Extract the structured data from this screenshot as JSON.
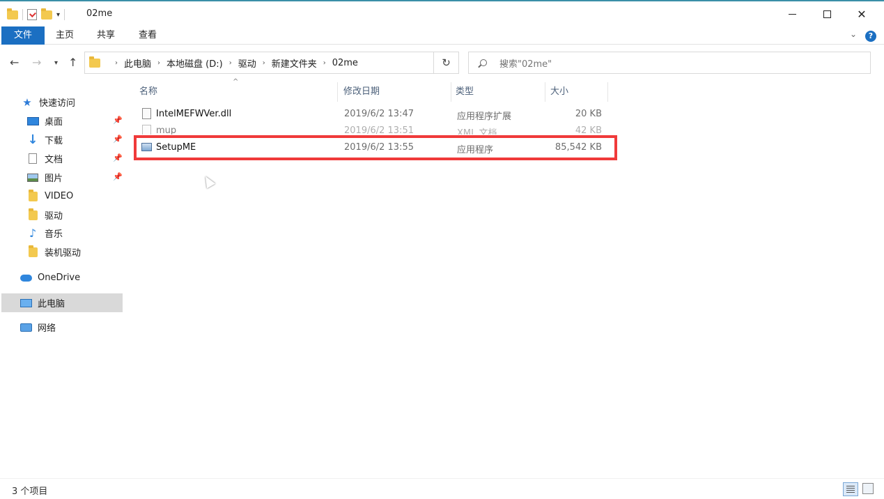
{
  "window": {
    "title": "02me",
    "controls": {
      "minimize": "minimize-icon",
      "maximize": "maximize-icon",
      "close": "✕"
    }
  },
  "ribbon": {
    "tabs": [
      "文件",
      "主页",
      "共享",
      "查看"
    ],
    "help": "?"
  },
  "navigation": {
    "breadcrumb": [
      "此电脑",
      "本地磁盘 (D:)",
      "驱动",
      "新建文件夹",
      "02me"
    ],
    "search_placeholder": "搜索\"02me\""
  },
  "sidebar": {
    "quick_access": "快速访问",
    "pinned": [
      {
        "label": "桌面",
        "icon": "desktop-icon"
      },
      {
        "label": "下载",
        "icon": "download-icon"
      },
      {
        "label": "文档",
        "icon": "document-icon"
      },
      {
        "label": "图片",
        "icon": "pictures-icon"
      }
    ],
    "folders": [
      {
        "label": "VIDEO",
        "icon": "folder-icon"
      },
      {
        "label": "驱动",
        "icon": "folder-icon"
      },
      {
        "label": "音乐",
        "icon": "music-icon"
      },
      {
        "label": "装机驱动",
        "icon": "folder-icon"
      }
    ],
    "onedrive": "OneDrive",
    "this_pc": "此电脑",
    "network": "网络"
  },
  "file_list": {
    "columns": [
      "名称",
      "修改日期",
      "类型",
      "大小"
    ],
    "rows": [
      {
        "name": "IntelMEFWVer.dll",
        "date": "2019/6/2 13:47",
        "type": "应用程序扩展",
        "size": "20 KB"
      },
      {
        "name": "mup",
        "date": "2019/6/2 13:51",
        "type": "XML 文档",
        "size": "42 KB"
      },
      {
        "name": "SetupME",
        "date": "2019/6/2 13:55",
        "type": "应用程序",
        "size": "85,542 KB"
      }
    ],
    "highlight_color": "#f03a3a"
  },
  "status_bar": {
    "item_count": "3 个项目"
  },
  "colors": {
    "accent": "#1b6fc2",
    "selected_nav": "#d9d9d9"
  }
}
